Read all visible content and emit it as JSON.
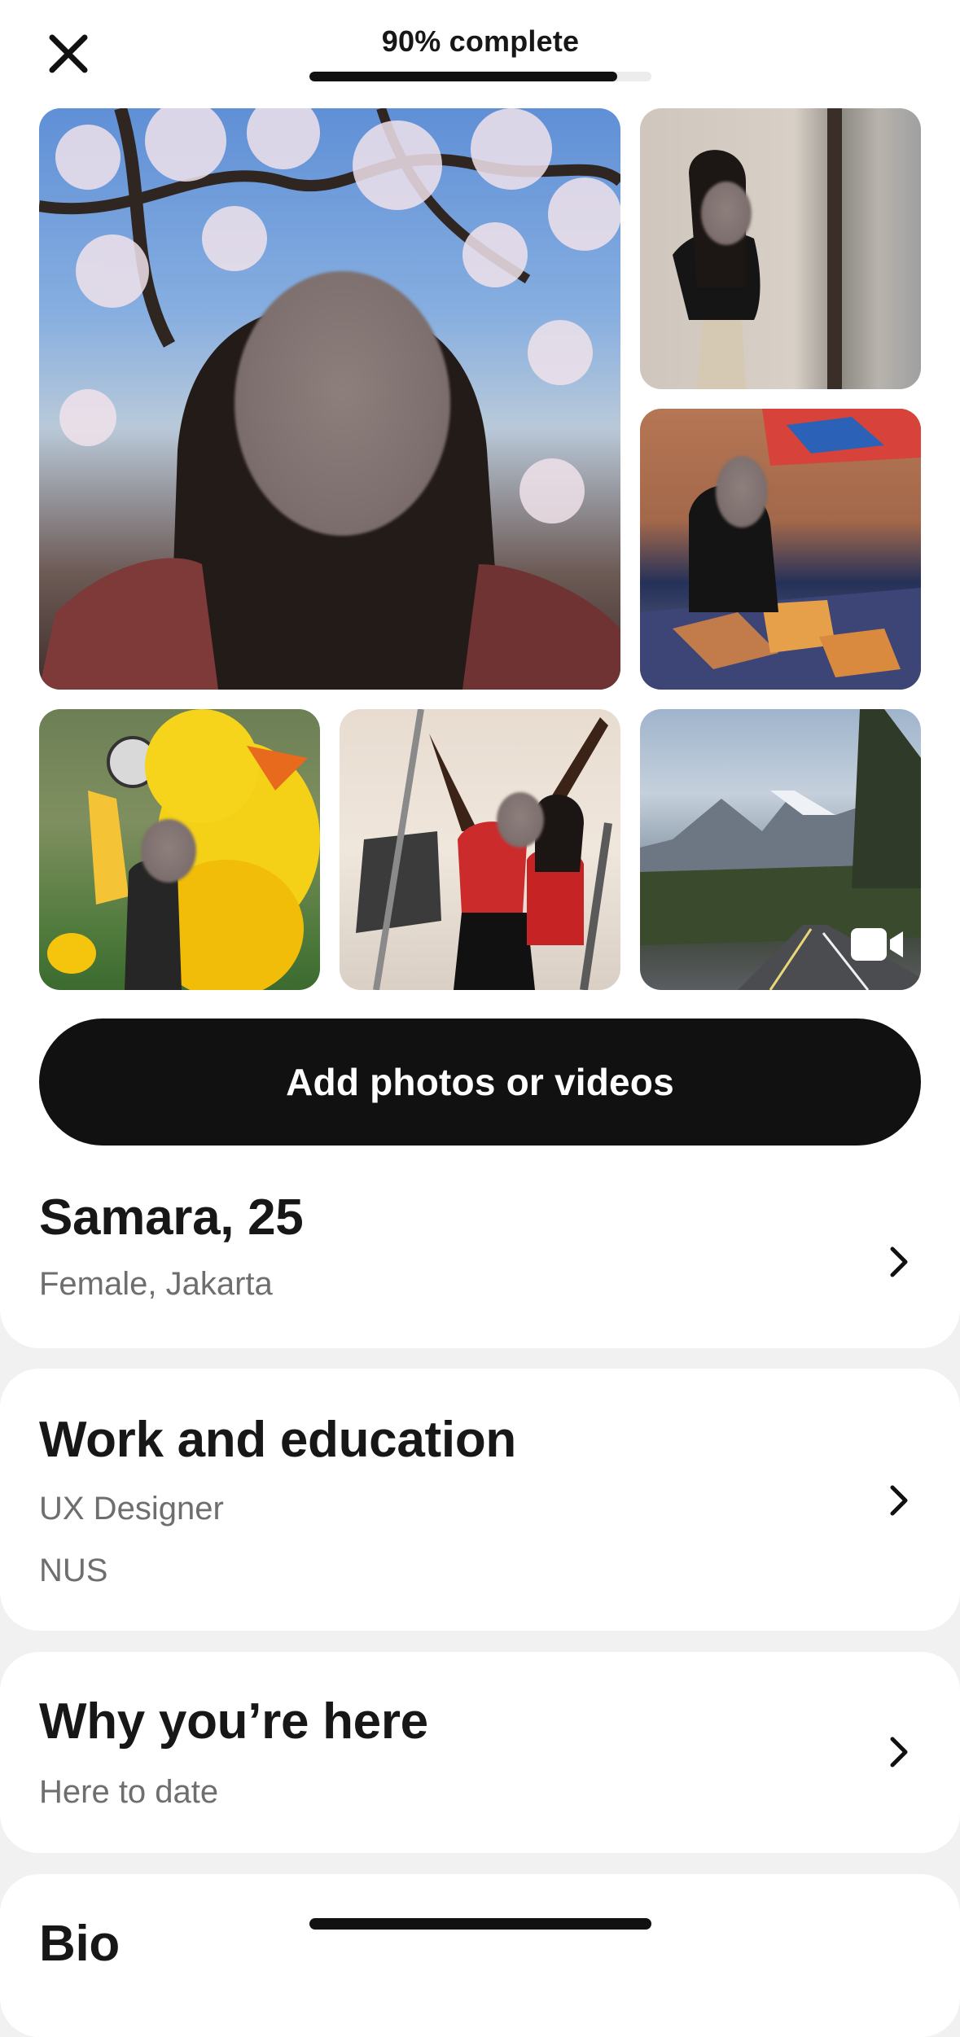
{
  "header": {
    "progress_label": "90% complete",
    "progress_fraction": 0.9
  },
  "photos": [
    {
      "name": "photo-1",
      "kind": "image"
    },
    {
      "name": "photo-2",
      "kind": "image"
    },
    {
      "name": "photo-3",
      "kind": "image"
    },
    {
      "name": "photo-4",
      "kind": "image"
    },
    {
      "name": "photo-5",
      "kind": "image"
    },
    {
      "name": "photo-6",
      "kind": "video",
      "icon": "video-camera-icon"
    }
  ],
  "add_button": {
    "label": "Add photos or videos"
  },
  "profile": {
    "name_age": "Samara, 25",
    "details": "Female, Jakarta"
  },
  "work": {
    "title": "Work and education",
    "job": "UX Designer",
    "school": "NUS"
  },
  "why": {
    "title": "Why you’re here",
    "value": "Here to date"
  },
  "bio": {
    "title": "Bio"
  },
  "icons": {
    "close": "close-icon",
    "chevron": "chevron-right-icon",
    "video": "video-camera-icon"
  },
  "colors": {
    "primary": "#111111",
    "background": "#f1f1f1",
    "card": "#ffffff",
    "secondary_text": "#6e6e6e"
  }
}
